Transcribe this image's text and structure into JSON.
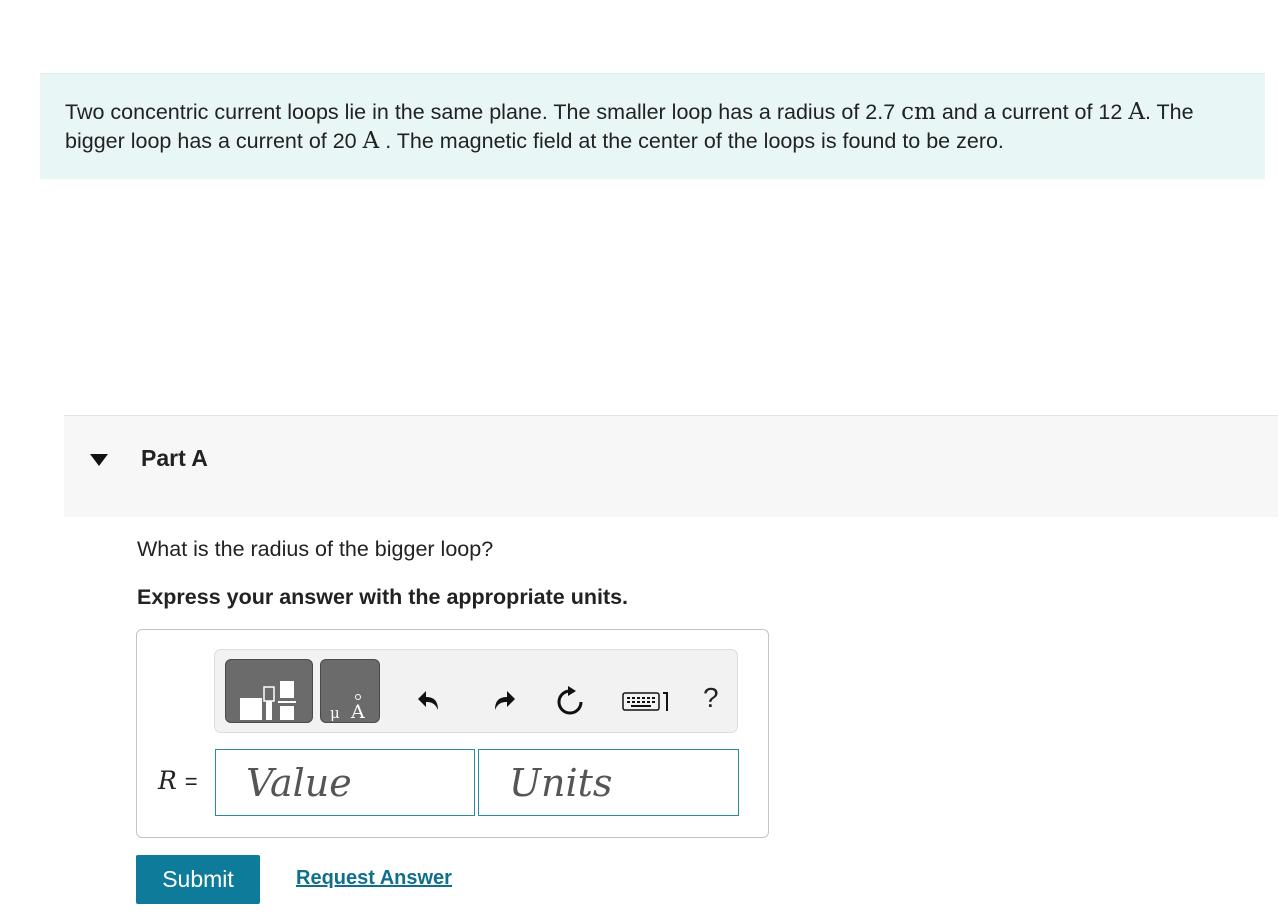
{
  "problem": {
    "text_1": "Two concentric current loops lie in the same plane. The smaller loop has a radius of 2.7 ",
    "radius_unit": "cm",
    "text_2": " and a current of 12",
    "current_unit_1": "A",
    "text_3": ". The bigger loop has a current of 20 ",
    "current_unit_2": "A",
    "text_4": " . The magnetic field at the center of the loops is found to be zero."
  },
  "part": {
    "title": "Part A",
    "question": "What is the radius of the bigger loop?",
    "instruction": "Express your answer with the appropriate units."
  },
  "toolbar": {
    "buttons": [
      {
        "icon": "templates-icon"
      },
      {
        "icon": "units-icon",
        "glyph": "μÅ"
      },
      {
        "icon": "undo-icon"
      },
      {
        "icon": "redo-icon"
      },
      {
        "icon": "reset-icon"
      },
      {
        "icon": "keyboard-icon"
      },
      {
        "icon": "help-icon",
        "glyph": "?"
      }
    ]
  },
  "answer": {
    "variable": "R",
    "equals": "=",
    "value_placeholder": "Value",
    "units_placeholder": "Units"
  },
  "actions": {
    "submit_label": "Submit",
    "request_label": "Request Answer"
  },
  "colors": {
    "problem_bg": "#e8f6f6",
    "submit_bg": "#0f7b9a",
    "link": "#0f6f8d",
    "field_border": "#2b8aa0"
  }
}
